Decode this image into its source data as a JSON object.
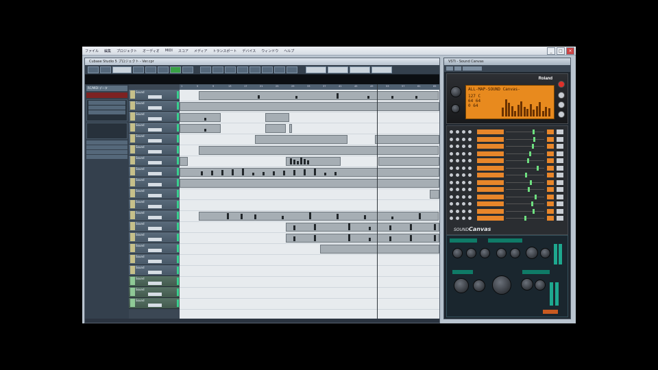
{
  "menubar": {
    "items": [
      "ファイル",
      "編集",
      "プロジェクト",
      "オーディオ",
      "MIDI",
      "スコア",
      "メディア",
      "トランスポート",
      "デバイス",
      "ウィンドウ",
      "ヘルプ"
    ]
  },
  "project_window": {
    "title": "Cubase Studio 5 プロジェクト - Ver.cpr",
    "toolbar_labels": [
      "",
      "",
      "",
      "",
      "",
      ""
    ],
    "inspector": {
      "header": "RC/MIDI データ",
      "rows": [
        "",
        "",
        "",
        "",
        "",
        ""
      ]
    },
    "tracks": [
      {
        "name": "Sound",
        "group": false
      },
      {
        "name": "Sound",
        "group": false
      },
      {
        "name": "Sound",
        "group": false
      },
      {
        "name": "Sound",
        "group": false
      },
      {
        "name": "Sound",
        "group": false
      },
      {
        "name": "Sound",
        "group": false
      },
      {
        "name": "Sound",
        "group": false
      },
      {
        "name": "Sound",
        "group": false
      },
      {
        "name": "Sound",
        "group": false
      },
      {
        "name": "Sound",
        "group": false
      },
      {
        "name": "Sound",
        "group": false
      },
      {
        "name": "Sound",
        "group": false
      },
      {
        "name": "Sound",
        "group": false
      },
      {
        "name": "Sound",
        "group": false
      },
      {
        "name": "Sound",
        "group": false
      },
      {
        "name": "Sound",
        "group": false
      },
      {
        "name": "Sound",
        "group": false
      },
      {
        "name": "Sound",
        "group": true
      },
      {
        "name": "Sound",
        "group": true
      },
      {
        "name": "Sound",
        "group": true
      }
    ],
    "ruler_marks": [
      "1",
      "5",
      "9",
      "13",
      "17",
      "21",
      "25",
      "29",
      "33",
      "37",
      "41",
      "45",
      "49",
      "53",
      "57",
      "61",
      "65"
    ]
  },
  "plugin": {
    "title": "VSTi - Sound Canvas",
    "brand": "Roland",
    "lcd_line1": "ALL-MAP-SOUND Canvas-",
    "lcd_line2a": "127  C",
    "lcd_line2b": " 64  64",
    "lcd_line2c": "  0  64",
    "product": "SOUND",
    "product2": "Canvas",
    "level_bars": [
      0.45,
      0.9,
      0.7,
      0.55,
      0.3,
      0.6,
      0.8,
      0.5,
      0.4,
      0.65,
      0.35,
      0.55,
      0.75,
      0.3,
      0.5,
      0.42
    ],
    "part_levels": [
      0.7,
      0.72,
      0.68,
      0.6,
      0.55,
      0.8,
      0.5,
      0.62,
      0.58,
      0.75,
      0.66,
      0.7,
      0.48
    ],
    "colors": {
      "lcd": "#e88a1e",
      "accent": "#1ea88f"
    }
  }
}
